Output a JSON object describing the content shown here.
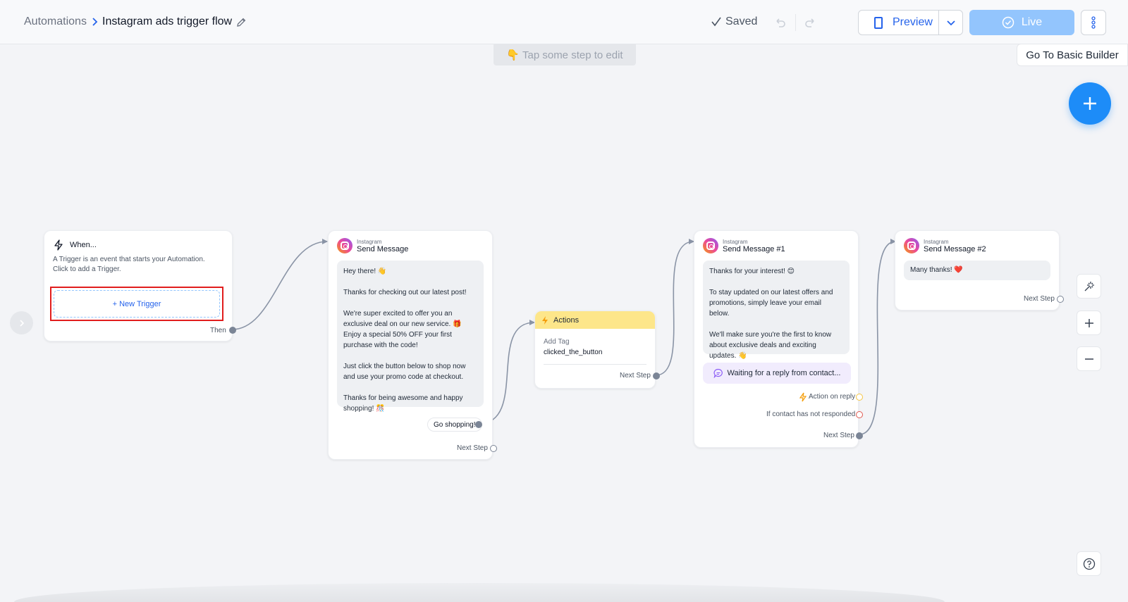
{
  "header": {
    "breadcrumb_root": "Automations",
    "flow_title": "Instagram ads trigger flow",
    "saved_label": "Saved",
    "preview_label": "Preview",
    "live_label": "Live"
  },
  "canvas": {
    "hint": "👇 Tap some step to edit",
    "basic_builder_label": "Go To Basic Builder"
  },
  "trigger_node": {
    "title": "When...",
    "description": "A Trigger is an event that starts your Automation.\nClick to add a Trigger.",
    "new_trigger_label": "+ New Trigger",
    "then_label": "Then"
  },
  "send_message_node": {
    "channel": "Instagram",
    "title": "Send Message",
    "message": "Hey there! 👋\n\nThanks for checking out our latest post!\n\nWe're super excited to offer you an exclusive deal on our new service. 🎁 Enjoy a special 50% OFF your first purchase with the code!\n\nJust click the button below to shop now and use your promo code at checkout.\n\nThanks for being awesome and happy shopping! 🎊",
    "button_label": "Go shopping!",
    "next_step_label": "Next Step"
  },
  "actions_node": {
    "title": "Actions",
    "action_type": "Add Tag",
    "action_value": "clicked_the_button",
    "next_step_label": "Next Step"
  },
  "send_message_1_node": {
    "channel": "Instagram",
    "title": "Send Message #1",
    "message": "Thanks for your interest! 😊\n\nTo stay updated on our latest offers and promotions, simply leave your email below.\n\nWe'll make sure you're the first to know about exclusive deals and exciting updates. 👋",
    "waiting_label": "Waiting for a reply from contact...",
    "action_on_reply_label": "Action on reply",
    "not_responded_label": "If contact has not responded",
    "next_step_label": "Next Step"
  },
  "send_message_2_node": {
    "channel": "Instagram",
    "title": "Send Message #2",
    "message": "Many thanks! ❤️",
    "next_step_label": "Next Step"
  }
}
